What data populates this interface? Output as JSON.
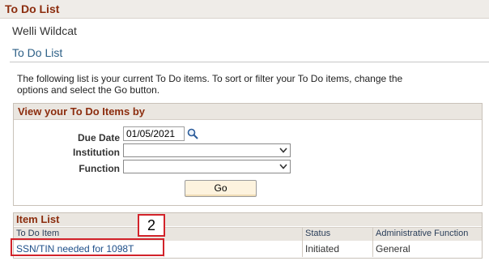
{
  "header": {
    "title": "To Do List"
  },
  "user": {
    "name": "Welli Wildcat"
  },
  "section": {
    "title": "To Do List"
  },
  "instructions": "The following list is your current To Do items. To sort or filter your To Do items, change the options and select the Go button.",
  "filters": {
    "title": "View your To Do Items by",
    "due_date_label": "Due Date",
    "due_date_value": "01/05/2021",
    "institution_label": "Institution",
    "institution_value": "",
    "function_label": "Function",
    "function_value": "",
    "go_label": "Go"
  },
  "item_list": {
    "title": "Item List",
    "columns": [
      "To Do Item",
      "Status",
      "Administrative Function"
    ],
    "rows": [
      {
        "item": "SSN/TIN needed for 1098T",
        "status": "Initiated",
        "function": "General"
      }
    ]
  },
  "annotation": {
    "step": "2",
    "color": "#d2232a"
  }
}
